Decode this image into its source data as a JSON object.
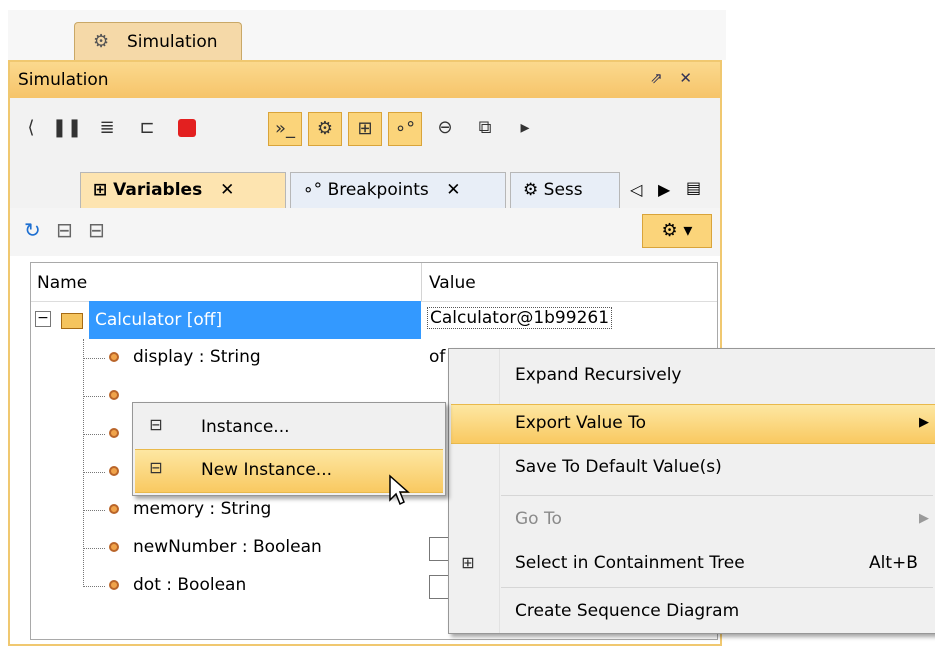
{
  "window": {
    "outer_tab": "Simulation",
    "title": "Simulation",
    "title_controls": "⇗ ✕"
  },
  "toolbar": {
    "icons": [
      "scroll-left-icon",
      "pause-icon",
      "step-into-icon",
      "step-over-icon",
      "stop-icon",
      "console-icon",
      "animation-icon",
      "tree-icon",
      "breakpoint-icon",
      "lock-icon",
      "export-icon",
      "scroll-right-icon"
    ]
  },
  "subtabs": {
    "variables": "Variables",
    "breakpoints": "Breakpoints",
    "sessions": "Sess",
    "close": "✕"
  },
  "tree": {
    "col_name": "Name",
    "col_value": "Value",
    "rows": [
      {
        "name": "Calculator [off]",
        "value": "Calculator@1b99261"
      },
      {
        "name": "display : String",
        "value": "of"
      },
      {
        "name": "",
        "value": ""
      },
      {
        "name": "",
        "value": ""
      },
      {
        "name": "",
        "value": ""
      },
      {
        "name": "memory : String",
        "value": ""
      },
      {
        "name": "newNumber : Boolean",
        "value": ""
      },
      {
        "name": "dot : Boolean",
        "value": ""
      }
    ]
  },
  "context_menu": {
    "items": [
      {
        "label": "Expand Recursively",
        "shortcut": ""
      },
      {
        "label": "Export Value To",
        "shortcut": ""
      },
      {
        "label": "Save To Default Value(s)",
        "shortcut": ""
      },
      {
        "label": "Go To",
        "shortcut": ""
      },
      {
        "label": "Select in Containment Tree",
        "shortcut": "Alt+B"
      },
      {
        "label": "Create Sequence Diagram",
        "shortcut": ""
      }
    ]
  },
  "submenu": {
    "items": [
      {
        "label": "Instance..."
      },
      {
        "label": "New Instance..."
      }
    ]
  },
  "colors": {
    "accent": "#f9c961",
    "selection": "#3399ff",
    "title_bar": "#f6c46a"
  }
}
